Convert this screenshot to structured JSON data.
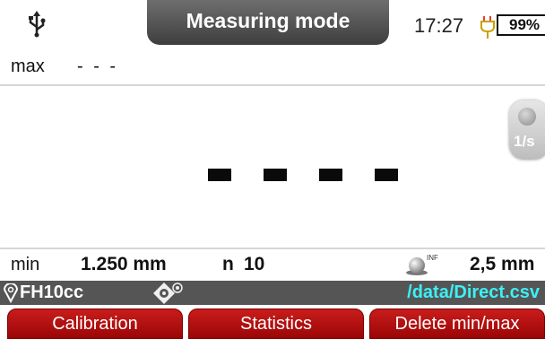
{
  "header": {
    "title": "Measuring mode",
    "time": "17:27",
    "battery_percent": "99%",
    "usb_icon": "usb-icon",
    "charging_icon": "plug-icon"
  },
  "max": {
    "label": "max",
    "value": "- - -"
  },
  "display": {
    "dashes": [
      "-",
      "-",
      "-",
      "-"
    ],
    "rate_label": "1/s"
  },
  "stats": {
    "min_label": "min",
    "min_value": "1.250 mm",
    "n_label": "n",
    "n_value": "10",
    "probe_infinity": "INF",
    "probe_size": "2,5 mm"
  },
  "status": {
    "probe_name": "FH10cc",
    "file_path": "/data/Direct.csv",
    "file_path_color": "#3df0f6"
  },
  "softkeys": [
    "Calibration",
    "Statistics",
    "Delete min/max"
  ],
  "colors": {
    "softkey": "#b01010",
    "statusbar": "#555555",
    "title_tab": "#555555"
  }
}
